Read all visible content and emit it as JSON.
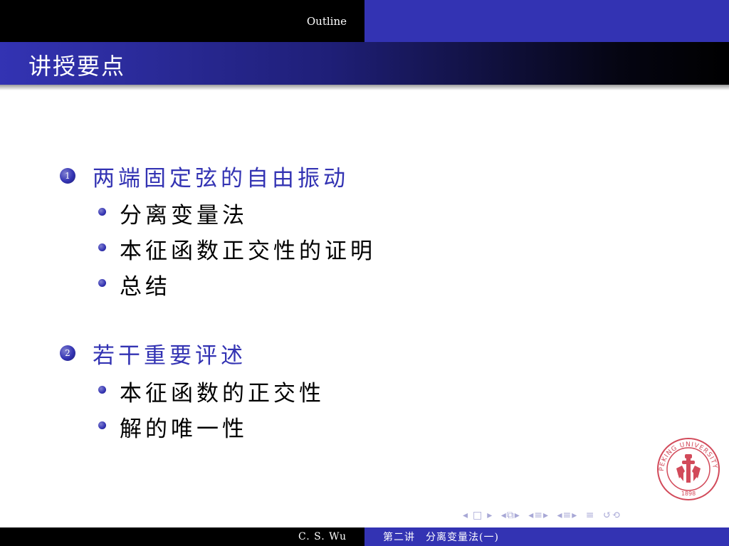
{
  "header": {
    "section": "Outline"
  },
  "frame": {
    "title": "讲授要点"
  },
  "outline": [
    {
      "number": "1",
      "title": "两端固定弦的自由振动",
      "items": [
        "分离变量法",
        "本征函数正交性的证明",
        "总结"
      ]
    },
    {
      "number": "2",
      "title": "若干重要评述",
      "items": [
        "本征函数的正交性",
        "解的唯一性"
      ]
    }
  ],
  "footer": {
    "author": "C. S. Wu",
    "title": "第二讲　分离变量法(一)"
  },
  "logo": {
    "text": "PEKING UNIVERSITY",
    "year": "1898"
  },
  "colors": {
    "structure": "#3333b3",
    "header_dark": "#000000",
    "seal": "#d24a5a"
  },
  "navigation": {
    "icons": [
      "nav-frame-prev-icon",
      "nav-frame-icon",
      "nav-frame-next-icon",
      "nav-subsection-icon",
      "nav-section-icon",
      "nav-doc-icon",
      "nav-align-icon",
      "nav-search-icon"
    ]
  }
}
